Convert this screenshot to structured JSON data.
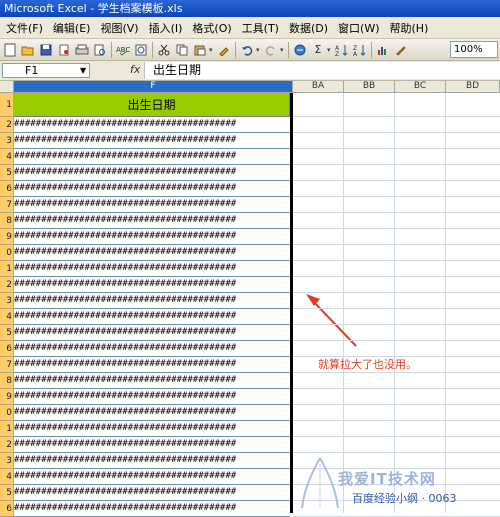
{
  "window": {
    "title": "Microsoft Excel - 学生档案模板.xls"
  },
  "menu": [
    "文件(F)",
    "编辑(E)",
    "视图(V)",
    "插入(I)",
    "格式(O)",
    "工具(T)",
    "数据(D)",
    "窗口(W)",
    "帮助(H)"
  ],
  "toolbar": {
    "zoom": "100%",
    "sigma": "Σ",
    "az_sort": "A↓Z"
  },
  "formula_bar": {
    "name_box": "F1",
    "fx": "fx",
    "content": "出生日期"
  },
  "columns": {
    "selected": "F",
    "others": [
      "BA",
      "BB",
      "BC",
      "BD"
    ]
  },
  "sheet": {
    "header_cell": "出生日期",
    "row_numbers": [
      "1",
      "2",
      "3",
      "4",
      "5",
      "6",
      "7",
      "8",
      "9",
      "0",
      "1",
      "2",
      "3",
      "4",
      "5",
      "6",
      "7",
      "8",
      "9",
      "0",
      "1",
      "2",
      "3",
      "4",
      "5",
      "6"
    ],
    "overflow_fill": "#########################################"
  },
  "annotation": {
    "text": "就算拉大了也没用。",
    "color": "#e03c28"
  },
  "watermark": {
    "main": "我爱IT技术网",
    "sub": "百度经验小纲 · 0063"
  }
}
